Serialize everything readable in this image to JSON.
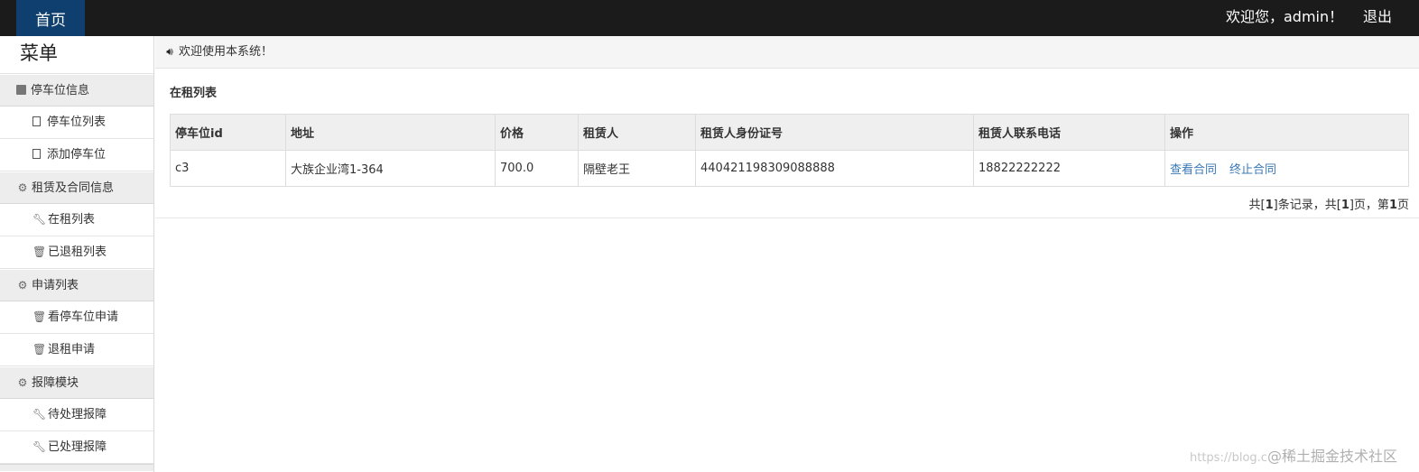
{
  "topbar": {
    "home_label": "首页",
    "welcome_text": "欢迎您，admin！",
    "logout_label": "退出"
  },
  "sidebar": {
    "title": "菜单",
    "groups": [
      {
        "label": "停车位信息",
        "icon": "id-card-icon",
        "items": [
          {
            "label": "停车位列表",
            "icon": "file-icon"
          },
          {
            "label": "添加停车位",
            "icon": "file-icon"
          }
        ]
      },
      {
        "label": "租赁及合同信息",
        "icon": "gear-icon",
        "items": [
          {
            "label": "在租列表",
            "icon": "wrench-icon"
          },
          {
            "label": "已退租列表",
            "icon": "trash-icon"
          }
        ]
      },
      {
        "label": "申请列表",
        "icon": "gear-icon",
        "items": [
          {
            "label": "看停车位申请",
            "icon": "trash-icon"
          },
          {
            "label": "退租申请",
            "icon": "trash-icon"
          }
        ]
      },
      {
        "label": "报障模块",
        "icon": "gear-icon",
        "items": [
          {
            "label": "待处理报障",
            "icon": "wrench-icon"
          },
          {
            "label": "已处理报障",
            "icon": "wrench-icon"
          }
        ]
      }
    ]
  },
  "main": {
    "notice": "欢迎使用本系统！",
    "panel_title": "在租列表",
    "table": {
      "headers": [
        "停车位id",
        "地址",
        "价格",
        "租赁人",
        "租赁人身份证号",
        "租赁人联系电话",
        "操作"
      ],
      "rows": [
        {
          "id": "c3",
          "address": "大族企业湾1-364",
          "price": "700.0",
          "tenant": "隔壁老王",
          "id_number": "440421198309088888",
          "phone": "18822222222",
          "actions": [
            "查看合同",
            "终止合同"
          ]
        }
      ]
    },
    "pager": {
      "p1": "共[",
      "total_records": "1",
      "p2": "]条记录，共[",
      "total_pages": "1",
      "p3": "]页，第",
      "current_page": "1",
      "p4": "页"
    }
  },
  "watermark": {
    "text1": "https://blog.c",
    "text2": "@稀土掘金技术社区"
  },
  "colors": {
    "topbar": "#1b1b1b",
    "home_tab": "#0f3f6e",
    "link": "#3a78b6",
    "menu_group_bg": "#ededed"
  }
}
